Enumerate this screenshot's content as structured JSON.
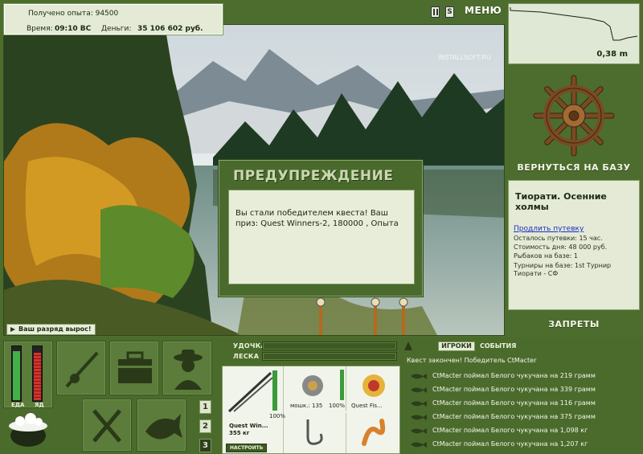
{
  "info": {
    "xp_label": "Получено опыта: 94500",
    "time_label": "Время:",
    "time_value": "09:10 ВС",
    "money_label": "Деньги:",
    "money_value": "35 106 602 руб."
  },
  "top": {
    "menu_label": "МЕНЮ",
    "sound_label": "S",
    "watermark": "INSTALLSOFT.RU"
  },
  "depth": {
    "value": "0,38 m"
  },
  "side": {
    "back_to_base": "ВЕРНУТЬСЯ НА БАЗУ",
    "location_title": "Тиорати. Осенние холмы",
    "extend_link": "Продлить путевку",
    "lines": [
      "Осталось путевки: 15 час.",
      "Стоимость дня: 48 000 руб.",
      "Рыбаков на базе: 1"
    ],
    "tournaments_1": "Турниры на базе: 1st Турнир",
    "tournaments_2": "Тиорати - СФ",
    "bans": "ЗАПРЕТЫ"
  },
  "dialog": {
    "title": "ПРЕДУПРЕЖДЕНИЕ",
    "body": "Вы стали победителем квеста! Ваш приз: Quest Winners-2, 180000 , Опыта"
  },
  "rank": {
    "text": "Ваш разряд вырос!"
  },
  "meters": {
    "food_label": "ЕДА",
    "poison_label": "ЯД",
    "food_level": 0.92,
    "poison_level": 0.9
  },
  "pages": [
    "1",
    "2",
    "3"
  ],
  "tackle": {
    "rod_label": "УДОЧКА",
    "line_label": "ЛЕСКА",
    "rod_name": "Quest Win...",
    "rod_weight": "355 кг",
    "rod_percent": "100%",
    "setup_button": "НАСТРОИТЬ",
    "reel_name": "мошк.: 135",
    "reel_percent": "100%",
    "line_name": "Quest Fis..."
  },
  "events": {
    "tab_players": "ИГРОКИ",
    "tab_events": "СОБЫТИЯ",
    "header": "Квест закончен! Победитель CtMacter",
    "rows": [
      "CtMacter поймал Белого чукучана на 219 грамм",
      "CtMacter поймал Белого чукучана на 339 грамм",
      "CtMacter поймал Белого чукучана на 116 грамм",
      "CtMacter поймал Белого чукучана на 375 грамм",
      "CtMacter поймал Белого чукучана на 1,098 кг",
      "CtMacter поймал Белого чукучана на 1,207 кг"
    ]
  },
  "colors": {
    "panel_bg": "#4b6b2d",
    "light_box": "#e4ead6",
    "food_fill": "#43b04a",
    "poison_fill": "#d6322c"
  }
}
